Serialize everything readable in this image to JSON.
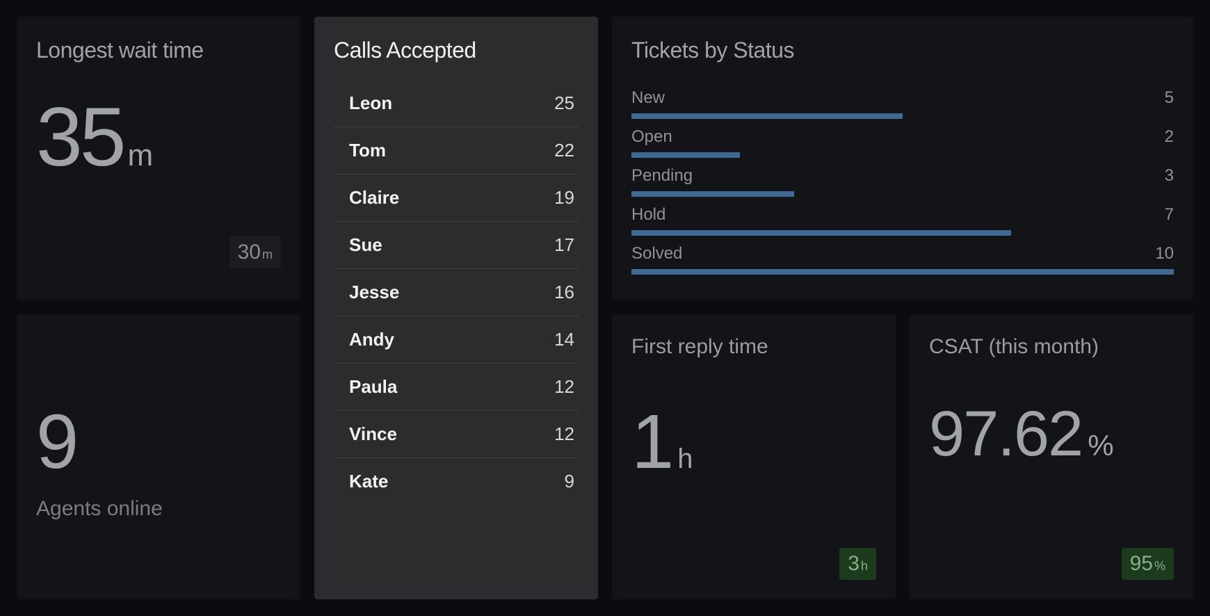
{
  "longest_wait": {
    "title": "Longest wait time",
    "value": "35",
    "unit": "m",
    "badge_value": "30",
    "badge_unit": "m"
  },
  "calls_accepted": {
    "title": "Calls Accepted",
    "rows": [
      {
        "name": "Leon",
        "value": 25
      },
      {
        "name": "Tom",
        "value": 22
      },
      {
        "name": "Claire",
        "value": 19
      },
      {
        "name": "Sue",
        "value": 17
      },
      {
        "name": "Jesse",
        "value": 16
      },
      {
        "name": "Andy",
        "value": 14
      },
      {
        "name": "Paula",
        "value": 12
      },
      {
        "name": "Vince",
        "value": 12
      },
      {
        "name": "Kate",
        "value": 9
      }
    ]
  },
  "tickets_by_status": {
    "title": "Tickets by Status"
  },
  "agents_online": {
    "value": "9",
    "label": "Agents online"
  },
  "first_reply": {
    "title": "First reply time",
    "value": "1",
    "unit": "h",
    "badge_value": "3",
    "badge_unit": "h"
  },
  "csat": {
    "title": "CSAT (this month)",
    "value": "97.62",
    "unit": "%",
    "badge_value": "95",
    "badge_unit": "%"
  },
  "chart_data": {
    "type": "bar",
    "title": "Tickets by Status",
    "categories": [
      "New",
      "Open",
      "Pending",
      "Hold",
      "Solved"
    ],
    "values": [
      5,
      2,
      3,
      7,
      10
    ],
    "max": 10,
    "orientation": "horizontal",
    "bar_color": "#3e6a94"
  }
}
